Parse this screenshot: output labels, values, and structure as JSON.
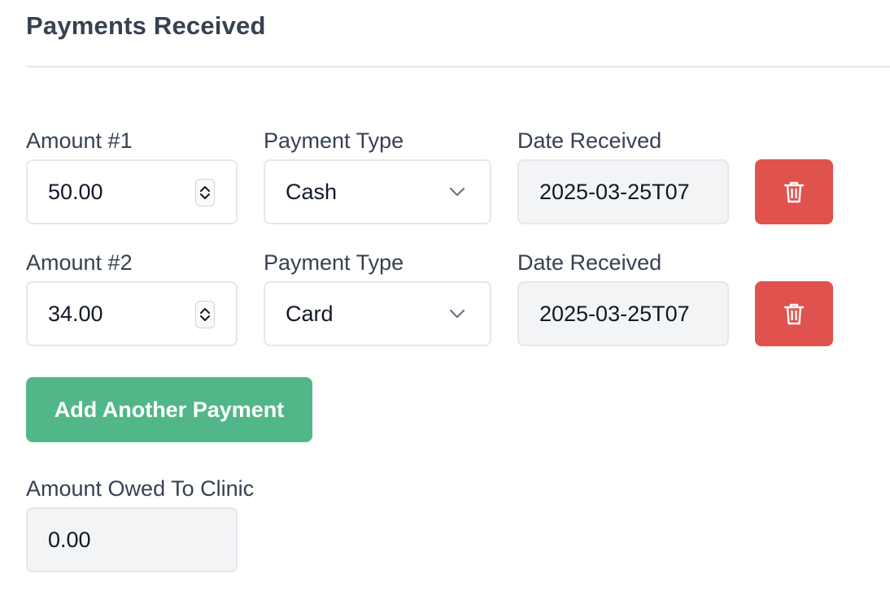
{
  "section": {
    "title": "Payments Received"
  },
  "payments": [
    {
      "amount_label": "Amount #1",
      "amount": "50.00",
      "type_label": "Payment Type",
      "type": "Cash",
      "date_label": "Date Received",
      "date": "2025-03-25T07"
    },
    {
      "amount_label": "Amount #2",
      "amount": "34.00",
      "type_label": "Payment Type",
      "type": "Card",
      "date_label": "Date Received",
      "date": "2025-03-25T07"
    }
  ],
  "add_button": {
    "label": "Add Another Payment"
  },
  "owed": {
    "label": "Amount Owed To Clinic",
    "value": "0.00"
  },
  "icons": {
    "delete": "trash-icon",
    "select": "chevron-down-icon",
    "stepper": "number-stepper-icon"
  },
  "colors": {
    "delete": "#e0524d",
    "add": "#52b788",
    "readonly_bg": "#f3f4f6",
    "border": "#e5e7eb",
    "heading": "#374151"
  }
}
